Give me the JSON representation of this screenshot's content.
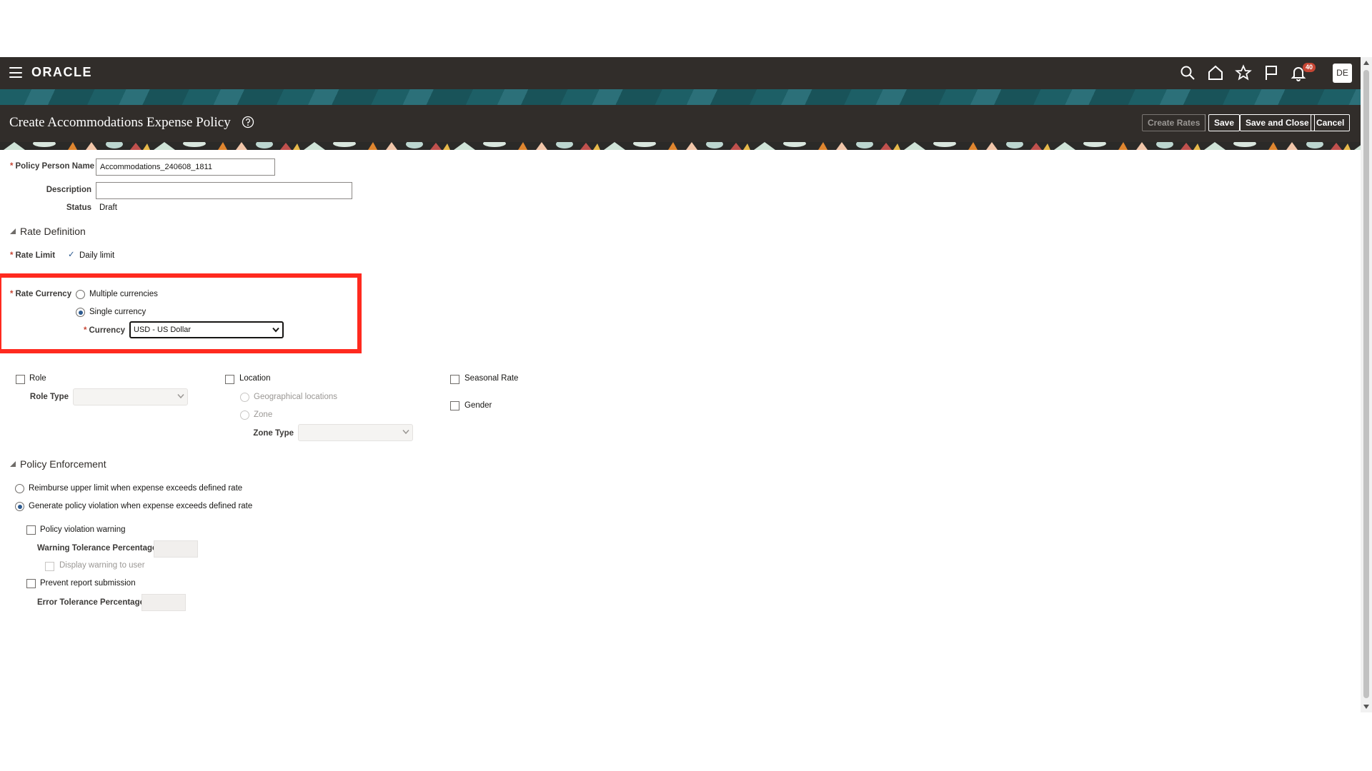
{
  "app": {
    "logo": "ORACLE",
    "notification_count": "40",
    "user_initials": "DE"
  },
  "page": {
    "title": "Create Accommodations Expense Policy"
  },
  "toolbar": {
    "create_rates": "Create Rates",
    "save": "Save",
    "save_and_close": "Save and Close",
    "cancel": "Cancel"
  },
  "form": {
    "policy_person_name_label": "Policy Person Name",
    "policy_person_name_value": "Accommodations_240608_1811",
    "description_label": "Description",
    "description_value": "",
    "status_label": "Status",
    "status_value": "Draft"
  },
  "rate_definition": {
    "heading": "Rate Definition",
    "rate_limit_label": "Rate Limit",
    "rate_limit_value": "Daily limit",
    "rate_currency_label": "Rate Currency",
    "multiple_currencies": "Multiple currencies",
    "single_currency": "Single currency",
    "currency_label": "Currency",
    "currency_value": "USD - US Dollar"
  },
  "determinants": {
    "role": "Role",
    "role_type_label": "Role Type",
    "location": "Location",
    "geographical_locations": "Geographical locations",
    "zone": "Zone",
    "zone_type_label": "Zone Type",
    "seasonal_rate": "Seasonal Rate",
    "gender": "Gender"
  },
  "policy_enforcement": {
    "heading": "Policy Enforcement",
    "reimburse_upper_limit": "Reimburse upper limit when expense exceeds defined rate",
    "generate_violation": "Generate policy violation when expense exceeds defined rate",
    "policy_violation_warning": "Policy violation warning",
    "warning_tolerance_label": "Warning Tolerance Percentage",
    "display_warning": "Display warning to user",
    "prevent_submission": "Prevent report submission",
    "error_tolerance_label": "Error Tolerance Percentage"
  },
  "colors": {
    "header_bg": "#312d2a",
    "teal_band": "#1d5f66",
    "highlight": "#ff2a1f",
    "required": "#c74634",
    "radio_selected": "#2c5a8f"
  }
}
